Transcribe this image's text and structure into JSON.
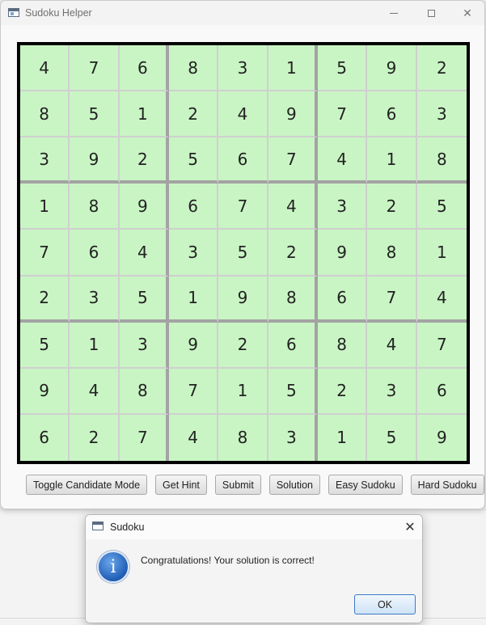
{
  "window": {
    "title": "Sudoku Helper",
    "minimize_glyph": "",
    "close_glyph": "✕"
  },
  "board": {
    "rows": [
      [
        4,
        7,
        6,
        8,
        3,
        1,
        5,
        9,
        2
      ],
      [
        8,
        5,
        1,
        2,
        4,
        9,
        7,
        6,
        3
      ],
      [
        3,
        9,
        2,
        5,
        6,
        7,
        4,
        1,
        8
      ],
      [
        1,
        8,
        9,
        6,
        7,
        4,
        3,
        2,
        5
      ],
      [
        7,
        6,
        4,
        3,
        5,
        2,
        9,
        8,
        1
      ],
      [
        2,
        3,
        5,
        1,
        9,
        8,
        6,
        7,
        4
      ],
      [
        5,
        1,
        3,
        9,
        2,
        6,
        8,
        4,
        7
      ],
      [
        9,
        4,
        8,
        7,
        1,
        5,
        2,
        3,
        6
      ],
      [
        6,
        2,
        7,
        4,
        8,
        3,
        1,
        5,
        9
      ]
    ],
    "cell_color": "#c9f5c4"
  },
  "buttons": {
    "toggle_candidate": "Toggle Candidate Mode",
    "get_hint": "Get Hint",
    "submit": "Submit",
    "solution": "Solution",
    "easy": "Easy Sudoku",
    "hard": "Hard Sudoku"
  },
  "dialog": {
    "title": "Sudoku",
    "close_glyph": "✕",
    "icon_glyph": "i",
    "message": "Congratulations! Your solution is correct!",
    "ok_label": "OK"
  }
}
